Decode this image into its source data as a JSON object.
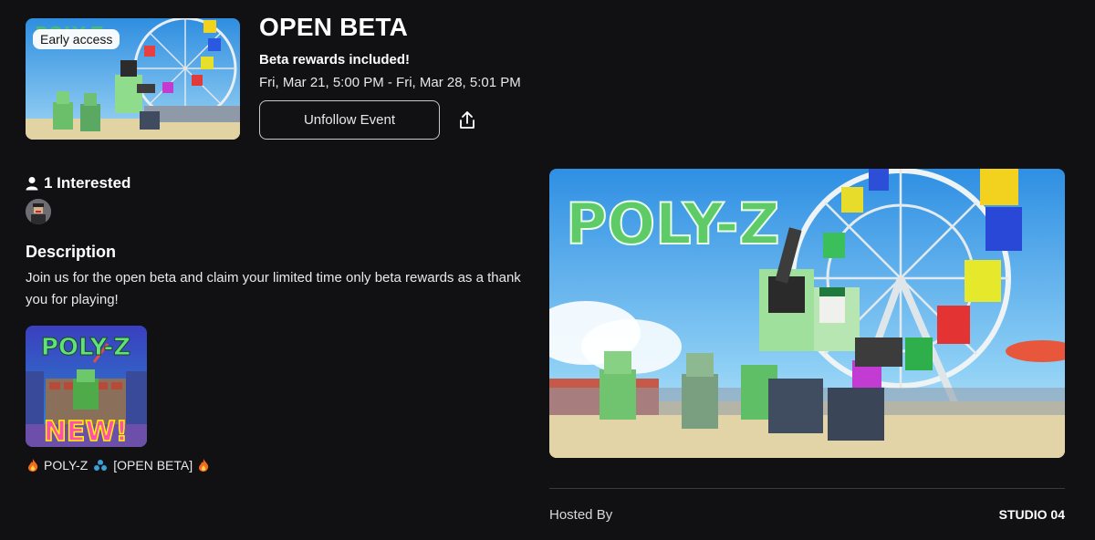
{
  "event": {
    "badge": "Early access",
    "title": "OPEN BETA",
    "subtitle": "Beta rewards included!",
    "dates": "Fri, Mar 21, 5:00 PM - Fri, Mar 28, 5:01 PM",
    "unfollow_label": "Unfollow Event"
  },
  "interested": {
    "label": "1 Interested"
  },
  "description": {
    "heading": "Description",
    "text": "Join us for the open beta and claim your limited time only beta rewards as a thank you for playing!"
  },
  "game": {
    "thumb_title": "POLY-Z",
    "thumb_new": "NEW!",
    "name": "POLY-Z",
    "name_suffix": "[OPEN BETA]"
  },
  "hero": {
    "logo": "POLY-Z"
  },
  "host": {
    "label": "Hosted By",
    "name": "STUDIO 04"
  },
  "colors": {
    "background": "#111113",
    "zombie_green": "#5fc86a",
    "sky": "#58b4ee"
  }
}
